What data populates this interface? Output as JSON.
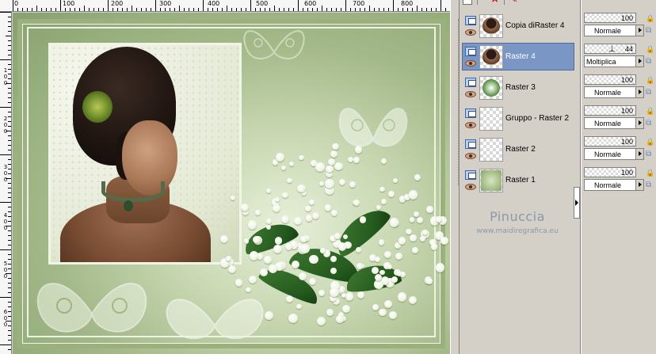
{
  "ruler": {
    "top_labels": [
      "0",
      "100",
      "200",
      "300",
      "400",
      "500",
      "600",
      "700",
      "800"
    ],
    "left_labels": [
      "1\n0\n0",
      "2\n0\n0",
      "3\n0\n0",
      "4\n0\n0",
      "5\n0\n0",
      "6\n0\n0"
    ]
  },
  "colors": {
    "selected_row": "#7a96c4",
    "panel_bg": "#d4d0c8",
    "watermark": "#8c98a8"
  },
  "toolbar": {
    "new_layer_icon": "new-layer-icon",
    "delete_icon": "delete-icon",
    "delete_glyph": "✕",
    "edit_icon": "brush-icon",
    "edit_glyph": "✎"
  },
  "layers": [
    {
      "name": "Copia diRaster 4",
      "opacity": "100",
      "blend": "Normale",
      "selected": false
    },
    {
      "name": "Raster 4",
      "opacity": "44",
      "blend": "Moltiplica",
      "selected": true
    },
    {
      "name": "Raster 3",
      "opacity": "100",
      "blend": "Normale",
      "selected": false
    },
    {
      "name": "Gruppo - Raster 2",
      "opacity": "100",
      "blend": "Normale",
      "selected": false
    },
    {
      "name": "Raster 2",
      "opacity": "100",
      "blend": "Normale",
      "selected": false
    },
    {
      "name": "Raster 1",
      "opacity": "100",
      "blend": "Normale",
      "selected": false
    }
  ],
  "watermark": {
    "name": "Pinuccia",
    "url": "www.maidiregrafica.eu"
  },
  "icons": {
    "visibility": "layer-type-icon",
    "eye": "eye-icon",
    "lock": "lock-icon",
    "lock_glyph": "🔒",
    "link": "link-icon",
    "link_glyph": "⧉",
    "slider_glyph": "⊥"
  }
}
